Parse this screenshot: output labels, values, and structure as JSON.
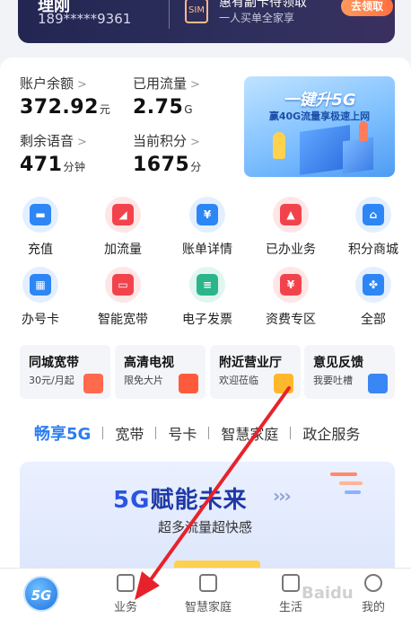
{
  "top_card": {
    "name": "理刚",
    "phone": "189*****9361",
    "promo_title": "惠有副卡待领取",
    "promo_sub": "一人买单全家享",
    "claim_label": "去领取",
    "sim_icon_text": "SIM"
  },
  "stats": [
    {
      "label": "账户余额",
      "value": "372.92",
      "unit": "元"
    },
    {
      "label": "已用流量",
      "value": "2.75",
      "unit": "G"
    },
    {
      "label": "剩余语音",
      "value": "471",
      "unit": "分钟"
    },
    {
      "label": "当前积分",
      "value": "1675",
      "unit": "分"
    }
  ],
  "chevron": ">",
  "banner_5g": {
    "title": "一键升5G",
    "subtitle": "赢40G流量享极速上网"
  },
  "grid": [
    {
      "label": "充值",
      "icon": "wallet-icon",
      "color": "blue",
      "glyph": "▬"
    },
    {
      "label": "加流量",
      "icon": "data-boost-icon",
      "color": "red",
      "glyph": "◢"
    },
    {
      "label": "账单详情",
      "icon": "bill-icon",
      "color": "blue",
      "glyph": "¥"
    },
    {
      "label": "已办业务",
      "icon": "bell-icon",
      "color": "red",
      "glyph": "▲"
    },
    {
      "label": "积分商城",
      "icon": "shop-icon",
      "color": "blue",
      "glyph": "⌂"
    },
    {
      "label": "办号卡",
      "icon": "sim-card-icon",
      "color": "blue",
      "glyph": "▦"
    },
    {
      "label": "智能宽带",
      "icon": "router-icon",
      "color": "red",
      "glyph": "▭"
    },
    {
      "label": "电子发票",
      "icon": "invoice-icon",
      "color": "green",
      "glyph": "≡"
    },
    {
      "label": "资费专区",
      "icon": "price-icon",
      "color": "red",
      "glyph": "¥"
    },
    {
      "label": "全部",
      "icon": "all-grid-icon",
      "color": "blue",
      "glyph": "✤"
    }
  ],
  "services": [
    {
      "title": "同城宽带",
      "sub": "30元/月起",
      "color": "#ff6a4d"
    },
    {
      "title": "高清电视",
      "sub": "限免大片",
      "color": "#ff5a3c"
    },
    {
      "title": "附近营业厅",
      "sub": "欢迎莅临",
      "color": "#ffb72b"
    },
    {
      "title": "意见反馈",
      "sub": "我要吐槽",
      "color": "#3a86f5"
    }
  ],
  "tabs": [
    "畅享5G",
    "宽带",
    "号卡",
    "智慧家庭",
    "政企服务"
  ],
  "big_banner": {
    "headline_5g": "5G",
    "headline_rest": "赋能未来",
    "arrows": "›››",
    "sub": "超多流量超快感"
  },
  "bottom_nav": [
    {
      "label": "业务",
      "icon": "business-icon"
    },
    {
      "label": "智慧家庭",
      "icon": "home-icon"
    },
    {
      "label": "生活",
      "icon": "bag-icon"
    },
    {
      "label": "我的",
      "icon": "user-icon"
    }
  ],
  "home_badge": "5G",
  "watermark": "Baidu",
  "colors": {
    "accent": "#2d7ef0",
    "annotation": "#e8222b"
  }
}
